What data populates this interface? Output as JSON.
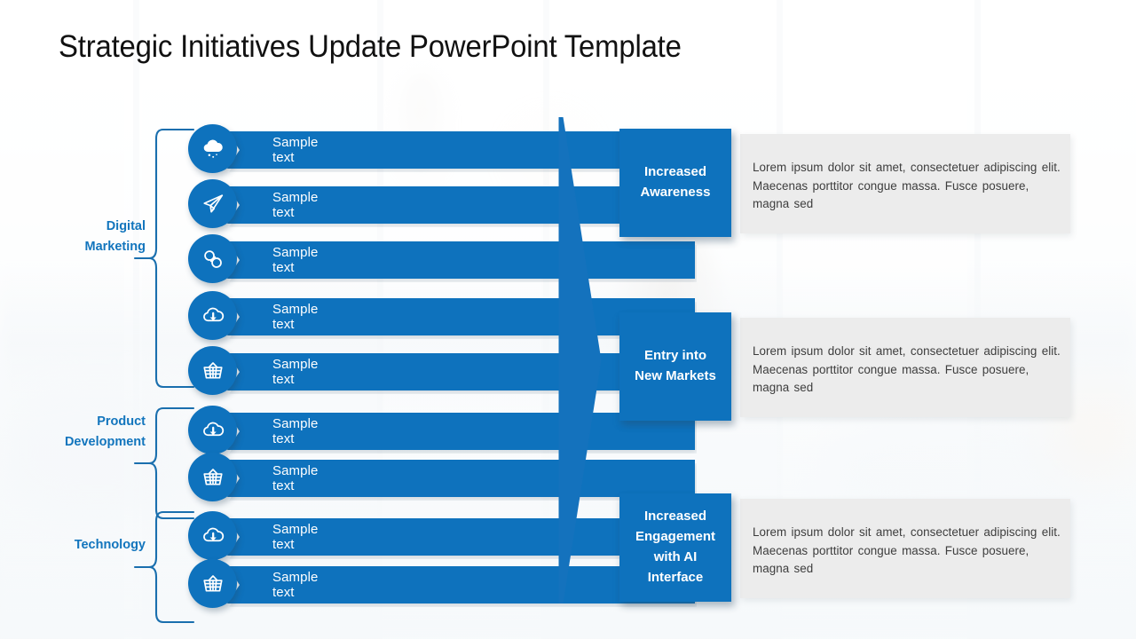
{
  "slide": {
    "title": "Strategic Initiatives Update PowerPoint Template",
    "accent_color": "#0e72bd",
    "label_color": "#1275bd",
    "body_panel_color": "#ececec",
    "title_color": "#111111",
    "background": "faded office interior photograph"
  },
  "left_panel": {
    "categories": [
      {
        "label": "Digital\nMarketing",
        "line1": "Digital",
        "line2": "Marketing",
        "item_count": 5
      },
      {
        "label": "Product\nDevelopment",
        "line1": "Product",
        "line2": "Development",
        "item_count": 2
      },
      {
        "label": "Technology",
        "line1": "Technology",
        "line2": "",
        "item_count": 2
      }
    ],
    "rows": [
      {
        "icon": "cloud-rain-icon",
        "text": "Sample text",
        "category": "Digital Marketing"
      },
      {
        "icon": "paper-plane-icon",
        "text": "Sample text",
        "category": "Digital Marketing"
      },
      {
        "icon": "chain-link-icon",
        "text": "Sample text",
        "category": "Digital Marketing"
      },
      {
        "icon": "cloud-download-icon",
        "text": "Sample text",
        "category": "Digital Marketing"
      },
      {
        "icon": "shopping-basket-icon",
        "text": "Sample text",
        "category": "Digital Marketing"
      },
      {
        "icon": "cloud-download-icon",
        "text": "Sample text",
        "category": "Product Development"
      },
      {
        "icon": "shopping-basket-icon",
        "text": "Sample text",
        "category": "Product Development"
      },
      {
        "icon": "cloud-download-icon",
        "text": "Sample text",
        "category": "Technology"
      },
      {
        "icon": "shopping-basket-icon",
        "text": "Sample text",
        "category": "Technology"
      }
    ]
  },
  "center": {
    "icon": "right-chevron-arrow"
  },
  "right_panel": {
    "cards": [
      {
        "heading": "Increased\nAwareness",
        "heading_line1": "Increased",
        "heading_line2": "Awareness",
        "heading_line3": "",
        "heading_line4": "",
        "body": "Lorem ipsum dolor sit amet, consectetuer adipiscing elit. Maecenas porttitor congue massa. Fusce posuere, magna sed"
      },
      {
        "heading": "Entry into\nNew Markets",
        "heading_line1": "Entry into",
        "heading_line2": "New Markets",
        "heading_line3": "",
        "heading_line4": "",
        "body": "Lorem ipsum dolor sit amet, consectetuer adipiscing elit. Maecenas porttitor congue massa. Fusce posuere, magna sed"
      },
      {
        "heading": "Increased Engagement with AI Interface",
        "heading_line1": "Increased",
        "heading_line2": "Engagement",
        "heading_line3": "with AI",
        "heading_line4": "Interface",
        "body": "Lorem ipsum dolor sit amet, consectetuer adipiscing elit. Maecenas porttitor congue massa. Fusce posuere, magna sed"
      }
    ]
  }
}
